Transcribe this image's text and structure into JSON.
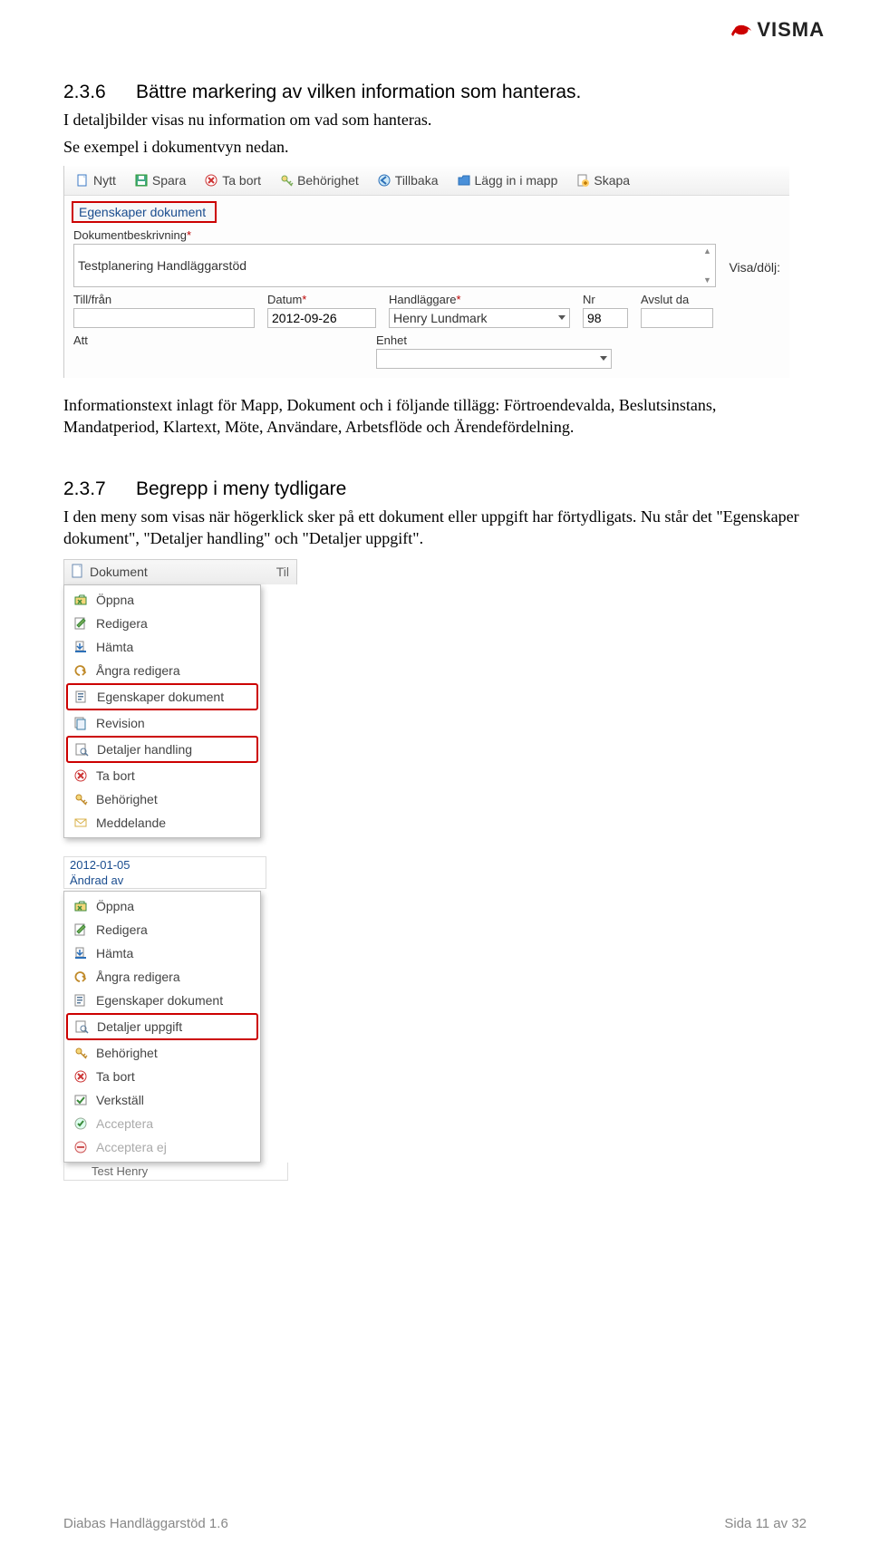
{
  "logo_text": "VISMA",
  "section1": {
    "num": "2.3.6",
    "title": "Bättre markering av vilken information som hanteras.",
    "p1": "I detaljbilder visas nu information om vad som hanteras.",
    "p2": "Se exempel i dokumentvyn nedan.",
    "p_after": "Informationstext inlagt för Mapp, Dokument och i följande tillägg: Förtroendevalda, Beslutsinstans, Mandatperiod, Klartext, Möte, Användare, Arbetsflöde och Ärendefördelning."
  },
  "shot1": {
    "toolbar": [
      {
        "icon": "new-icon",
        "label": "Nytt",
        "color": "#3b78c4"
      },
      {
        "icon": "save-icon",
        "label": "Spara",
        "color": "#2d9a2d"
      },
      {
        "icon": "delete-icon",
        "label": "Ta bort",
        "color": "#c33"
      },
      {
        "icon": "perm-icon",
        "label": "Behörighet",
        "color": "#7a5"
      },
      {
        "icon": "back-icon",
        "label": "Tillbaka",
        "color": "#2b6fb8"
      },
      {
        "icon": "folder-icon",
        "label": "Lägg in i mapp",
        "color": "#2b6fb8"
      },
      {
        "icon": "create-icon",
        "label": "Skapa",
        "color": "#555"
      }
    ],
    "tab": "Egenskaper dokument",
    "desc_label": "Dokumentbeskrivning",
    "desc_value": "Testplanering Handläggarstöd",
    "visadolj": "Visa/dölj:",
    "tillfran": "Till/från",
    "datum_label": "Datum",
    "datum_value": "2012-09-26",
    "handl_label": "Handläggare",
    "handl_value": "Henry Lundmark",
    "nr_label": "Nr",
    "nr_value": "98",
    "avslut_label": "Avslut da",
    "att_label": "Att",
    "enhet_label": "Enhet"
  },
  "section2": {
    "num": "2.3.7",
    "title": "Begrepp i meny tydligare",
    "p1": "I den meny som visas när högerklick sker på ett dokument eller uppgift har förtydligats. Nu står det \"Egenskaper dokument\", \"Detaljer handling\" och \"Detaljer uppgift\"."
  },
  "menu1": {
    "header": "Dokument",
    "header_col2": "Til",
    "items": [
      {
        "icon": "open-icon",
        "label": "Öppna",
        "color": "#3a8a3a"
      },
      {
        "icon": "edit-icon",
        "label": "Redigera",
        "color": "#3a8a3a"
      },
      {
        "icon": "download-icon",
        "label": "Hämta",
        "color": "#2b6fb8"
      },
      {
        "icon": "undo-icon",
        "label": "Ångra redigera",
        "color": "#c08a2a"
      },
      {
        "icon": "props-icon",
        "label": "Egenskaper dokument",
        "boxed": true,
        "color": "#5a7a9a"
      },
      {
        "icon": "rev-icon",
        "label": "Revision",
        "color": "#3a7aa0"
      },
      {
        "icon": "detail-icon",
        "label": "Detaljer handling",
        "boxed": true,
        "color": "#5a7a9a"
      },
      {
        "icon": "delete-icon",
        "label": "Ta bort",
        "color": "#c33"
      },
      {
        "icon": "perm-icon",
        "label": "Behörighet",
        "color": "#c08a2a"
      },
      {
        "icon": "msg-icon",
        "label": "Meddelande",
        "color": "#d8b04a"
      }
    ]
  },
  "menu2": {
    "pre_line1": "2012-01-05",
    "pre_line2": "Ändrad av",
    "items": [
      {
        "icon": "open-icon",
        "label": "Öppna",
        "color": "#3a8a3a"
      },
      {
        "icon": "edit-icon",
        "label": "Redigera",
        "color": "#3a8a3a"
      },
      {
        "icon": "download-icon",
        "label": "Hämta",
        "color": "#2b6fb8"
      },
      {
        "icon": "undo-icon",
        "label": "Ångra redigera",
        "color": "#c08a2a"
      },
      {
        "icon": "props-icon",
        "label": "Egenskaper dokument",
        "color": "#5a7a9a"
      },
      {
        "icon": "detail-icon",
        "label": "Detaljer uppgift",
        "boxed": true,
        "color": "#5a7a9a"
      },
      {
        "icon": "perm-icon",
        "label": "Behörighet",
        "color": "#c08a2a"
      },
      {
        "icon": "delete-icon",
        "label": "Ta bort",
        "color": "#c33"
      },
      {
        "icon": "exec-icon",
        "label": "Verkställ",
        "color": "#555"
      },
      {
        "icon": "accept-icon",
        "label": "Acceptera",
        "disabled": true,
        "color": "#9a9"
      },
      {
        "icon": "reject-icon",
        "label": "Acceptera ej",
        "disabled": true,
        "color": "#c55"
      }
    ],
    "below": "Test Henry"
  },
  "footer": {
    "left": "Diabas Handläggarstöd 1.6",
    "right": "Sida 11 av 32"
  }
}
